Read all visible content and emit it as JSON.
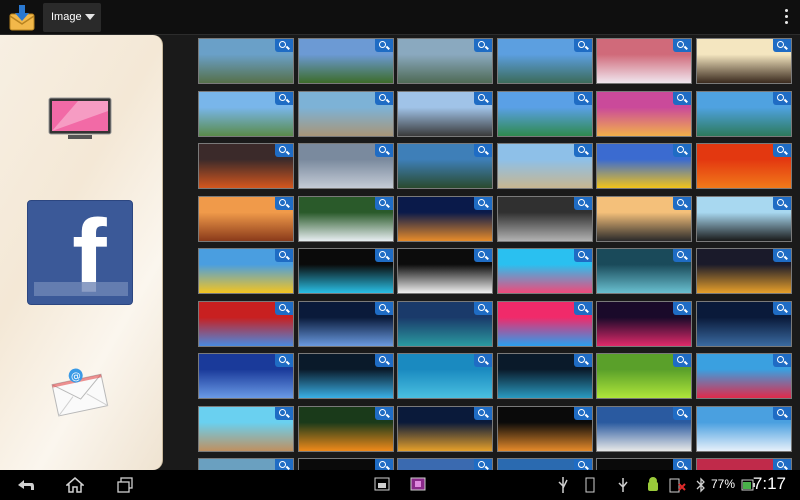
{
  "action_bar": {
    "app_icon": "download-envelope-icon",
    "spinner_label": "Image",
    "overflow_icon": "overflow-menu-icon"
  },
  "share_panel": {
    "targets": [
      {
        "name": "tv-share-icon"
      },
      {
        "name": "facebook-share-icon",
        "label": "f"
      },
      {
        "name": "email-share-icon"
      }
    ]
  },
  "grid": {
    "columns": 6,
    "rows": [
      [
        [
          "#6aa0c8",
          "#56704a"
        ],
        [
          "#6c9ad4",
          "#3d6c2a"
        ],
        [
          "#8aa9bf",
          "#4f6a55"
        ],
        [
          "#5c9fe0",
          "#3c6b5a"
        ],
        [
          "#d06a7a",
          "#f0e6ee"
        ],
        [
          "#f4e6c0",
          "#3a2a1e"
        ]
      ],
      [
        [
          "#79b6ea",
          "#5a8b4a"
        ],
        [
          "#7db2d6",
          "#a89678"
        ],
        [
          "#a0c3e8",
          "#3a3a3a"
        ],
        [
          "#5aa0e6",
          "#2f8a4e"
        ],
        [
          "#ca4a9a",
          "#f2b04a"
        ],
        [
          "#4fa2e0",
          "#2d7a5c"
        ]
      ],
      [
        [
          "#3b2a2a",
          "#d4561e"
        ],
        [
          "#7a8a9e",
          "#c5ccd6"
        ],
        [
          "#3e7fb8",
          "#2a4a2e"
        ],
        [
          "#8ec0e8",
          "#c7b690"
        ],
        [
          "#3b6bd0",
          "#f2c41a"
        ],
        [
          "#e33810",
          "#f27a1a"
        ]
      ],
      [
        [
          "#f09a4a",
          "#8a3a1a"
        ],
        [
          "#2a5a2a",
          "#e8eef2"
        ],
        [
          "#0a1a4a",
          "#e88c2a"
        ],
        [
          "#303030",
          "#b2b2b2"
        ],
        [
          "#f4c07a",
          "#2a2a2a"
        ],
        [
          "#a8d8f0",
          "#1a1a1a"
        ]
      ],
      [
        [
          "#4a9ee0",
          "#f4c420"
        ],
        [
          "#0a0a0a",
          "#2ac0e6"
        ],
        [
          "#0c0c0c",
          "#f0f0f0"
        ],
        [
          "#2ac0f0",
          "#f04a7a"
        ],
        [
          "#1a4a5a",
          "#6ac0d0"
        ],
        [
          "#1a1a2a",
          "#e8a02a"
        ]
      ],
      [
        [
          "#c82020",
          "#4a8ae0"
        ],
        [
          "#0a1a3a",
          "#6a9ae0"
        ],
        [
          "#1a3a6a",
          "#2a9aa0"
        ],
        [
          "#f02a6a",
          "#2aa0f0"
        ],
        [
          "#1a0a2a",
          "#e02a6a"
        ],
        [
          "#0a1a3a",
          "#3a6aa0"
        ]
      ],
      [
        [
          "#1a3a9a",
          "#6a9ae6"
        ],
        [
          "#0a1a2a",
          "#3ab0e6"
        ],
        [
          "#1a8ac0",
          "#4ac0e0"
        ],
        [
          "#0a1a2a",
          "#2a9ac0"
        ],
        [
          "#5aa02a",
          "#b0e63a"
        ],
        [
          "#3aa0e0",
          "#e02a4a"
        ]
      ],
      [
        [
          "#6ad0f0",
          "#c09060"
        ],
        [
          "#1a3a1a",
          "#f08a1a"
        ],
        [
          "#0a1a3a",
          "#e6a02a"
        ],
        [
          "#0a0a0a",
          "#e68a2a"
        ],
        [
          "#2a5aa0",
          "#e8e8e8"
        ],
        [
          "#4aa0e0",
          "#e6f0fa"
        ]
      ],
      [
        [
          "#6aa0c0",
          "#3a6a2a"
        ],
        [
          "#0a0a0a",
          "#4a4a4a"
        ],
        [
          "#3a6ab0",
          "#9ac0e0"
        ],
        [
          "#2a6ab0",
          "#6aa0d0"
        ],
        [
          "#0a0a0a",
          "#2a2a2a"
        ],
        [
          "#c02a4a",
          "#2a9ae0"
        ]
      ]
    ]
  },
  "nav_bar": {
    "back_icon": "back-icon",
    "home_icon": "home-icon",
    "recents_icon": "recent-apps-icon",
    "battery_percent": "77%",
    "time": "7:17"
  }
}
